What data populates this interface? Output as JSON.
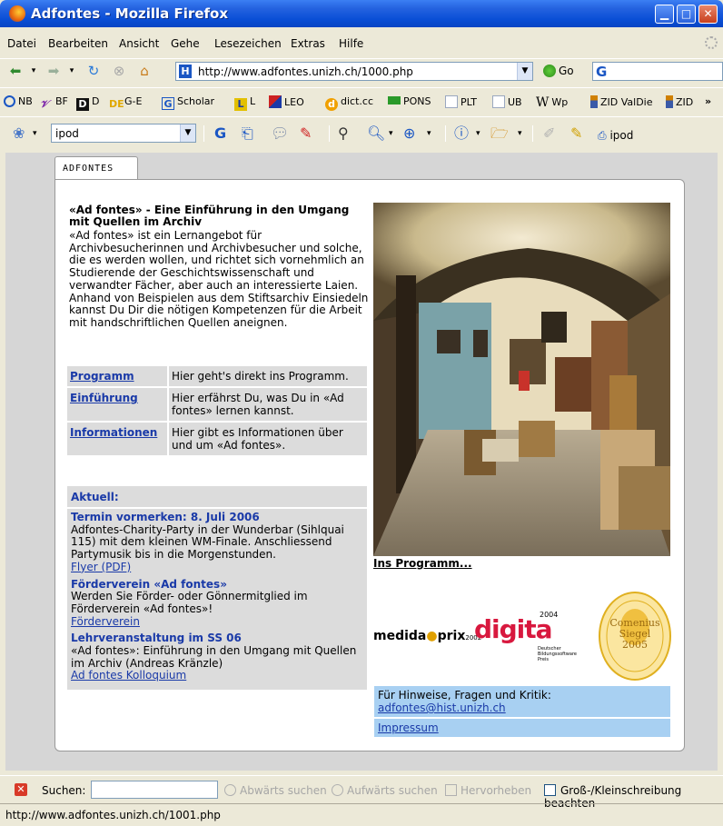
{
  "window": {
    "title": "Adfontes - Mozilla Firefox"
  },
  "menu": [
    "Datei",
    "Bearbeiten",
    "Ansicht",
    "Gehe",
    "Lesezeichen",
    "Extras",
    "Hilfe"
  ],
  "nav": {
    "url": "http://www.adfontes.unizh.ch/1000.php",
    "go_label": "Go"
  },
  "bookmarks": [
    {
      "label": "NB",
      "icon": "at-icon",
      "color": "#1a56c4"
    },
    {
      "label": "BF",
      "icon": "bf-icon",
      "color": "#7a1fa8"
    },
    {
      "label": "D",
      "icon": "d-icon",
      "color": "#111111"
    },
    {
      "label": "G-E",
      "icon": "de-icon",
      "color": "#e0a800"
    },
    {
      "label": "Scholar",
      "icon": "g-icon",
      "color": "#1a56c4"
    },
    {
      "label": "L",
      "icon": "l-icon",
      "color": "#e3c000"
    },
    {
      "label": "LEO",
      "icon": "flag-icon",
      "color": "#cc2222"
    },
    {
      "label": "dict.cc",
      "icon": "dict-icon",
      "color": "#f0a000"
    },
    {
      "label": "PONS",
      "icon": "pons-icon",
      "color": "#2a9a2a"
    },
    {
      "label": "PLT",
      "icon": "page-icon",
      "color": "#c0c8d8"
    },
    {
      "label": "UB",
      "icon": "page-icon",
      "color": "#c0c8d8"
    },
    {
      "label": "Wp",
      "icon": "w-icon",
      "color": "#333333"
    },
    {
      "label": "ZID ValDie",
      "icon": "bottle-icon",
      "color": "#d08000"
    },
    {
      "label": "ZID",
      "icon": "bottle-icon",
      "color": "#d08000"
    }
  ],
  "search": {
    "query": "ipod",
    "ipod_label": "ipod"
  },
  "page": {
    "tab": "ADFONTES",
    "intro_title": "«Ad fontes» - Eine Einführung in den Umgang mit Quellen im Archiv",
    "intro_text": "«Ad fontes» ist ein Lernangebot für Archivbesucherinnen und Archivbesucher und solche, die es werden wollen, und richtet sich vornehmlich an Studierende der Geschichtswissenschaft und verwandter Fächer, aber auch an interessierte Laien. Anhand von Beispielen aus dem Stiftsarchiv Einsiedeln kannst Du Dir die nötigen Kompetenzen für die Arbeit mit handschriftlichen Quellen aneignen.",
    "nav_rows": [
      {
        "link": "Programm",
        "desc": "Hier geht's direkt ins Programm."
      },
      {
        "link": "Einführung",
        "desc": "Hier erfährst Du, was Du in «Ad fontes» lernen kannst."
      },
      {
        "link": "Informationen",
        "desc": "Hier gibt es Informationen über und um «Ad fontes»."
      }
    ],
    "news_heading": "Aktuell:",
    "news": [
      {
        "title": "Termin vormerken: 8. Juli 2006",
        "text": "Adfontes-Charity-Party in der Wunderbar (Sihlquai 115) mit dem kleinen WM-Finale. Anschliessend Partymusik bis in die Morgenstunden.",
        "link": "Flyer (PDF)"
      },
      {
        "title": "Förderverein «Ad fontes»",
        "text": "Werden Sie Förder- oder Gönnermitglied im Förderverein «Ad fontes»!",
        "link": "Förderverein"
      },
      {
        "title": "Lehrveranstaltung im SS 06",
        "text": "«Ad fontes»: Einführung in den Umgang mit Quellen im Archiv (Andreas Kränzle)",
        "link": "Ad fontes Kolloquium"
      }
    ],
    "photo_link": "Ins Programm...",
    "logos": {
      "medida_a": "medida",
      "medida_b": "prix",
      "medida_year": "2002",
      "digita": "digita",
      "digita_year": "2004",
      "digita_sub": "Deutscher Bildungssoftware Preis",
      "comenius_line1": "Comenius",
      "comenius_line2": "Siegel",
      "comenius_year": "2005"
    },
    "contact_text": "Für Hinweise, Fragen und Kritik:",
    "contact_email": "adfontes@hist.unizh.ch",
    "impressum": "Impressum"
  },
  "findbar": {
    "label": "Suchen:",
    "next": "Abwärts suchen",
    "prev": "Aufwärts suchen",
    "highlight": "Hervorheben",
    "match_case": "Groß-/Kleinschreibung beachten"
  },
  "status": "http://www.adfontes.unizh.ch/1001.php"
}
